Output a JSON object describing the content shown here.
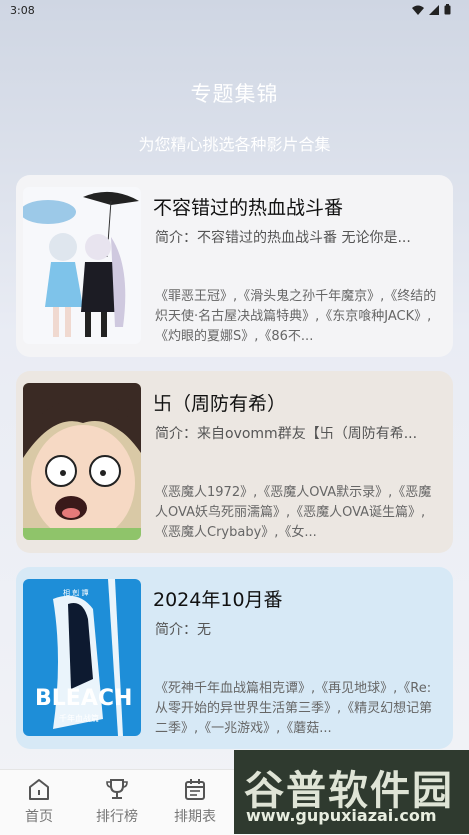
{
  "status": {
    "time": "3:08"
  },
  "header": {
    "title": "专题集锦",
    "subtitle": "为您精心挑选各种影片合集"
  },
  "cards": [
    {
      "title": "不容错过的热血战斗番",
      "intro": "简介：不容错过的热血战斗番 无论你是...",
      "list": "《罪恶王冠》,《滑头鬼之孙千年魔京》,《终结的炽天使·名古屋决战篇特典》,《东京喰种JACK》,《灼眼的夏娜S》,《86不..."
    },
    {
      "title": "卐（周防有希）",
      "intro": "简介：来自ovomm群友【卐（周防有希...",
      "list": "《恶魔人1972》,《恶魔人OVA默示录》,《恶魔人OVA妖鸟死丽濡篇》,《恶魔人OVA诞生篇》,《恶魔人Crybaby》,《女..."
    },
    {
      "title": "2024年10月番",
      "intro": "简介：无",
      "list": "《死神千年血战篇相克谭》,《再见地球》,《Re:从零开始的异世界生活第三季》,《精灵幻想记第二季》,《一兆游戏》,《蘑菇..."
    }
  ],
  "cover3": {
    "top_text": "相 剋 譚",
    "logo": "BLEACH",
    "sub": "千年血战篇"
  },
  "nav": [
    {
      "label": "首页",
      "icon": "home-icon"
    },
    {
      "label": "排行榜",
      "icon": "trophy-icon"
    },
    {
      "label": "排期表",
      "icon": "calendar-icon"
    }
  ],
  "watermark": {
    "main": "谷普软件园",
    "url": "www.gupuxiazai.com"
  },
  "colors": {
    "card1": "#f4f4f6",
    "card2": "#ece7e2",
    "card3": "#d7e9f6"
  }
}
